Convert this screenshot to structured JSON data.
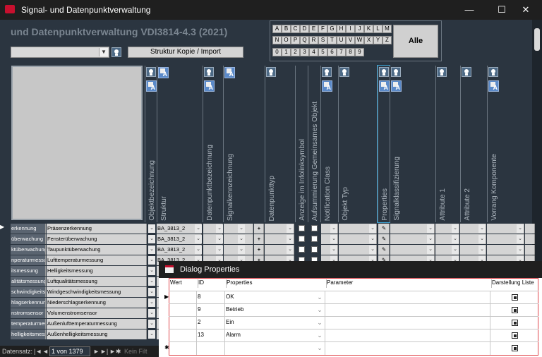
{
  "window": {
    "title": "Signal- und Datenpunktverwaltung",
    "minimize": "—",
    "maximize": "☐",
    "close": "✕"
  },
  "header": {
    "title": "und Datenpunktverwaltung VDI3814-4.3 (2021)",
    "import_button": "Struktur Kopie / Import"
  },
  "alphabet": {
    "row1": [
      "A",
      "B",
      "C",
      "D",
      "E",
      "F",
      "G",
      "H",
      "I",
      "J",
      "K",
      "L",
      "M"
    ],
    "row2": [
      "N",
      "O",
      "P",
      "Q",
      "R",
      "S",
      "T",
      "U",
      "V",
      "W",
      "X",
      "Y",
      "Z"
    ],
    "row3": [
      "0",
      "1",
      "2",
      "3",
      "4",
      "5",
      "6",
      "7",
      "8",
      "9"
    ],
    "all_button": "Alle"
  },
  "columns": [
    {
      "label": "Objektbezeichnung"
    },
    {
      "label": "Struktur"
    },
    {
      "label": "Datenpunktbezeichnung"
    },
    {
      "label": "Signalkennzeichnung"
    },
    {
      "label": "Datenpunkttyp"
    },
    {
      "label": "Anzeige im Infolinksymbol"
    },
    {
      "label": "Aufsummierung Gemeinsames Objekt"
    },
    {
      "label": "Notification Class"
    },
    {
      "label": "Objekt Typ"
    },
    {
      "label": "Properties"
    },
    {
      "label": "Signalklassifizierung"
    },
    {
      "label": "Attribute 1"
    },
    {
      "label": "Attribute 2"
    },
    {
      "label": "Vorrang Komponente"
    }
  ],
  "rows": [
    {
      "c1": "erkennung",
      "c2": "Präsenzerkennung",
      "struktur": "BA_3813_2",
      "plus": "+"
    },
    {
      "c1": "überwachung",
      "c2": "Fensterüberwachung",
      "struktur": "BA_3813_2",
      "plus": "+"
    },
    {
      "c1": "ktüberwachung",
      "c2": "Taupunktüberwachung",
      "struktur": "BA_3813_2",
      "plus": "+"
    },
    {
      "c1": "nperaturmessu",
      "c2": "Lufttemperaturmessung",
      "struktur": "BA_3813_2",
      "plus": "+"
    },
    {
      "c1": "itsmessung",
      "c2": "Helligkeitsmessung",
      "struktur": "",
      "plus": ""
    },
    {
      "c1": "alitätsmessung",
      "c2": "Luftqualitätsmessung",
      "struktur": "",
      "plus": ""
    },
    {
      "c1": "schwindigkeitsr",
      "c2": "Windgeschwindigkeitsmessung",
      "struktur": "",
      "plus": ""
    },
    {
      "c1": "hlagserkennun",
      "c2": "Niederschlagserkennung",
      "struktur": "",
      "plus": ""
    },
    {
      "c1": "nstromsensor",
      "c2": "Volumenstromsensor",
      "struktur": "",
      "plus": ""
    },
    {
      "c1": "temperaturmes",
      "c2": "Außenlufttemperaturmessung",
      "struktur": "",
      "plus": ""
    },
    {
      "c1": "helligkeitsmess",
      "c2": "Außenhelligkeitsmessung",
      "struktur": "",
      "plus": ""
    }
  ],
  "navigation": {
    "label": "Datensatz:",
    "first": "|◄",
    "prev": "◄",
    "position": "1 von 1379",
    "next": "►",
    "last": "►|",
    "new": "►✱",
    "filter": "Kein Filt"
  },
  "dialog": {
    "title": "Dialog Properties",
    "headers": {
      "wert": "Wert",
      "id": "ID",
      "properties": "Properties",
      "parameter": "Parameter",
      "darstellung": "Darstellung Liste"
    },
    "rows": [
      {
        "wert": "",
        "id": "8",
        "property": "OK",
        "parameter": ""
      },
      {
        "wert": "",
        "id": "9",
        "property": "Betrieb",
        "parameter": ""
      },
      {
        "wert": "",
        "id": "2",
        "property": "Ein",
        "parameter": ""
      },
      {
        "wert": "",
        "id": "13",
        "property": "Alarm",
        "parameter": ""
      },
      {
        "wert": "",
        "id": "",
        "property": "",
        "parameter": ""
      }
    ],
    "new_row_marker": "✱"
  }
}
